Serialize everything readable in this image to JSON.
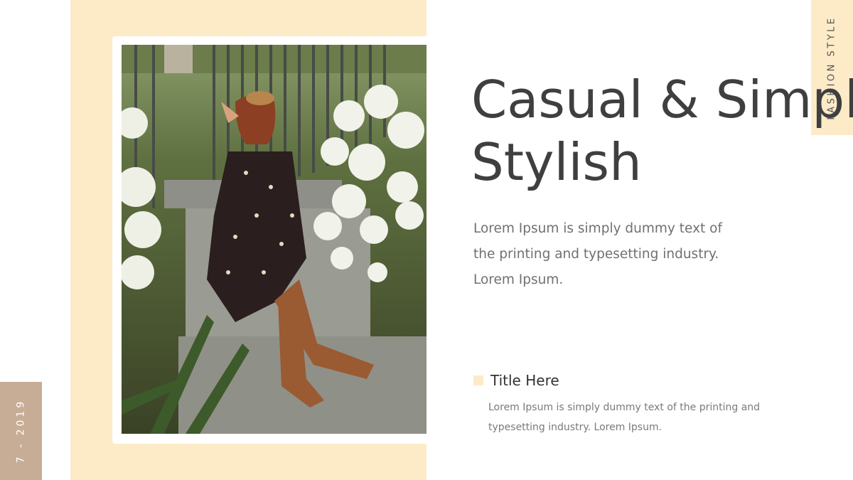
{
  "theme": {
    "cream": "#fdebc8",
    "tan": "#c8ad96"
  },
  "slide": {
    "date_tag": "7 - 2019",
    "section_tag": "FASHION STYLE",
    "headline_line1": "Casual & Simple",
    "headline_line2": "Stylish",
    "body": "Lorem Ipsum is simply dummy text of the printing and typesetting industry. Lorem Ipsum.",
    "subtitle": "Title Here",
    "subtitle_body": "Lorem Ipsum is simply dummy text of the printing and typesetting industry. Lorem Ipsum."
  },
  "image": {
    "description_icon": "fashion-photo"
  }
}
